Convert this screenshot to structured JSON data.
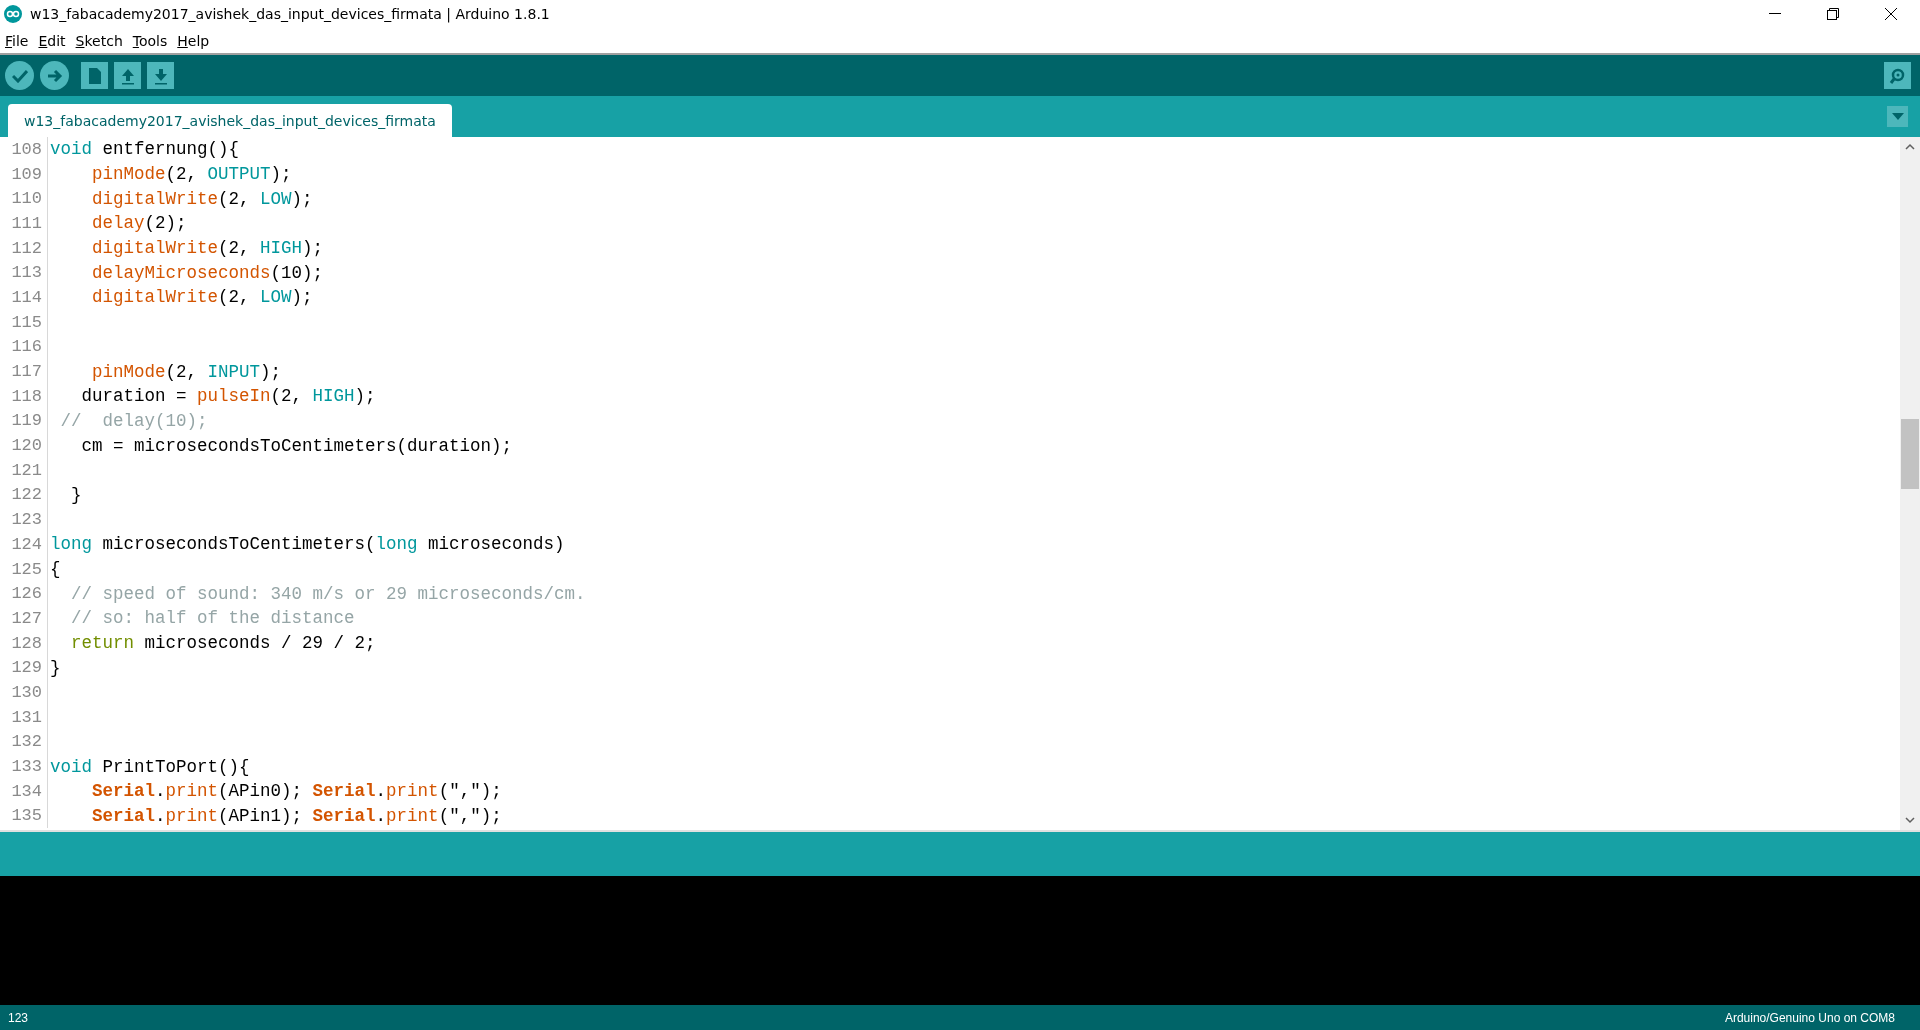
{
  "window": {
    "title": "w13_fabacademy2017_avishek_das_input_devices_firmata | Arduino 1.8.1"
  },
  "menu": [
    "File",
    "Edit",
    "Sketch",
    "Tools",
    "Help"
  ],
  "tabs": [
    {
      "label": "w13_fabacademy2017_avishek_das_input_devices_firmata",
      "selected": true
    }
  ],
  "editor": {
    "lines": [
      {
        "number": "108",
        "tokens": [
          {
            "kind": "keyword",
            "text": "void"
          },
          {
            "kind": "plain",
            "text": " entfernung(){"
          }
        ]
      },
      {
        "number": "109",
        "tokens": [
          {
            "kind": "function",
            "text": "    pinMode"
          },
          {
            "kind": "plain",
            "text": "(2, "
          },
          {
            "kind": "constant",
            "text": "OUTPUT"
          },
          {
            "kind": "plain",
            "text": ");"
          }
        ]
      },
      {
        "number": "110",
        "tokens": [
          {
            "kind": "function",
            "text": "    digitalWrite"
          },
          {
            "kind": "plain",
            "text": "(2, "
          },
          {
            "kind": "constant",
            "text": "LOW"
          },
          {
            "kind": "plain",
            "text": ");"
          }
        ]
      },
      {
        "number": "111",
        "tokens": [
          {
            "kind": "function",
            "text": "    delay"
          },
          {
            "kind": "plain",
            "text": "(2);"
          }
        ]
      },
      {
        "number": "112",
        "tokens": [
          {
            "kind": "function",
            "text": "    digitalWrite"
          },
          {
            "kind": "plain",
            "text": "(2, "
          },
          {
            "kind": "constant",
            "text": "HIGH"
          },
          {
            "kind": "plain",
            "text": ");"
          }
        ]
      },
      {
        "number": "113",
        "tokens": [
          {
            "kind": "function",
            "text": "    delayMicroseconds"
          },
          {
            "kind": "plain",
            "text": "(10);"
          }
        ]
      },
      {
        "number": "114",
        "tokens": [
          {
            "kind": "function",
            "text": "    digitalWrite"
          },
          {
            "kind": "plain",
            "text": "(2, "
          },
          {
            "kind": "constant",
            "text": "LOW"
          },
          {
            "kind": "plain",
            "text": ");"
          }
        ]
      },
      {
        "number": "115"
      },
      {
        "number": "116"
      },
      {
        "number": "117",
        "tokens": [
          {
            "kind": "function",
            "text": "    pinMode"
          },
          {
            "kind": "plain",
            "text": "(2, "
          },
          {
            "kind": "constant",
            "text": "INPUT"
          },
          {
            "kind": "plain",
            "text": ");"
          }
        ]
      },
      {
        "number": "118",
        "tokens": [
          {
            "kind": "plain",
            "text": "   duration = "
          },
          {
            "kind": "function",
            "text": "pulseIn"
          },
          {
            "kind": "plain",
            "text": "(2, "
          },
          {
            "kind": "constant",
            "text": "HIGH"
          },
          {
            "kind": "plain",
            "text": ");"
          }
        ]
      },
      {
        "number": "119",
        "tokens": [
          {
            "kind": "comment",
            "text": " //  delay(10);"
          }
        ]
      },
      {
        "number": "120",
        "tokens": [
          {
            "kind": "plain",
            "text": "   cm = microsecondsToCentimeters(duration);"
          }
        ]
      },
      {
        "number": "121"
      },
      {
        "number": "122",
        "tokens": [
          {
            "kind": "plain",
            "text": "  }"
          }
        ]
      },
      {
        "number": "123"
      },
      {
        "number": "124",
        "tokens": [
          {
            "kind": "keyword",
            "text": "long"
          },
          {
            "kind": "plain",
            "text": " microsecondsToCentimeters("
          },
          {
            "kind": "keyword",
            "text": "long"
          },
          {
            "kind": "plain",
            "text": " microseconds)"
          }
        ]
      },
      {
        "number": "125",
        "tokens": [
          {
            "kind": "plain",
            "text": "{"
          }
        ]
      },
      {
        "number": "126",
        "tokens": [
          {
            "kind": "comment",
            "text": "  // speed of sound: 340 m/s or 29 microseconds/cm."
          }
        ]
      },
      {
        "number": "127",
        "tokens": [
          {
            "kind": "comment",
            "text": "  // so: half of the distance"
          }
        ]
      },
      {
        "number": "128",
        "tokens": [
          {
            "kind": "control",
            "text": "  return"
          },
          {
            "kind": "plain",
            "text": " microseconds / 29 / 2;"
          }
        ]
      },
      {
        "number": "129",
        "tokens": [
          {
            "kind": "plain",
            "text": "}"
          }
        ]
      },
      {
        "number": "130"
      },
      {
        "number": "131"
      },
      {
        "number": "132"
      },
      {
        "number": "133",
        "tokens": [
          {
            "kind": "keyword",
            "text": "void"
          },
          {
            "kind": "plain",
            "text": " PrintToPort(){"
          }
        ]
      },
      {
        "number": "134",
        "tokens": [
          {
            "kind": "class",
            "text": "    Serial"
          },
          {
            "kind": "plain",
            "text": "."
          },
          {
            "kind": "function",
            "text": "print"
          },
          {
            "kind": "plain",
            "text": "(APin0); "
          },
          {
            "kind": "class",
            "text": "Serial"
          },
          {
            "kind": "plain",
            "text": "."
          },
          {
            "kind": "function",
            "text": "print"
          },
          {
            "kind": "plain",
            "text": "(\",\");"
          }
        ]
      },
      {
        "number": "135",
        "tokens": [
          {
            "kind": "class",
            "text": "    Serial"
          },
          {
            "kind": "plain",
            "text": "."
          },
          {
            "kind": "function",
            "text": "print"
          },
          {
            "kind": "plain",
            "text": "(APin1); "
          },
          {
            "kind": "class",
            "text": "Serial"
          },
          {
            "kind": "plain",
            "text": "."
          },
          {
            "kind": "function",
            "text": "print"
          },
          {
            "kind": "plain",
            "text": "(\",\");"
          }
        ]
      }
    ]
  },
  "status_bar": {
    "line": "123",
    "board": "Arduino/Genuino Uno on COM8"
  }
}
